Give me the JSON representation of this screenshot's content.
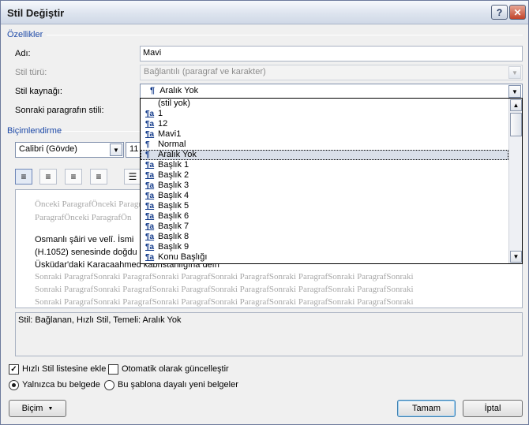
{
  "window": {
    "title": "Stil Değiştir",
    "help_label": "?",
    "close_label": "✕"
  },
  "properties": {
    "group_label": "Özellikler",
    "name_label": "Adı:",
    "name_value": "Mavi",
    "type_label": "Stil türü:",
    "type_value": "Bağlantılı (paragraf ve karakter)",
    "based_on_label": "Stil kaynağı:",
    "based_on_value": "Aralık Yok",
    "based_on_icon": "¶",
    "next_style_label": "Sonraki paragrafın stili:"
  },
  "style_list": {
    "items": [
      {
        "label": "(stil yok)",
        "icon": ""
      },
      {
        "label": "1",
        "icon": "¶a"
      },
      {
        "label": "12",
        "icon": "¶a"
      },
      {
        "label": "Mavi1",
        "icon": "¶a"
      },
      {
        "label": "Normal",
        "icon": "¶"
      },
      {
        "label": "Aralık Yok",
        "icon": "¶"
      },
      {
        "label": "Başlık 1",
        "icon": "¶a"
      },
      {
        "label": "Başlık 2",
        "icon": "¶a"
      },
      {
        "label": "Başlık 3",
        "icon": "¶a"
      },
      {
        "label": "Başlık 4",
        "icon": "¶a"
      },
      {
        "label": "Başlık 5",
        "icon": "¶a"
      },
      {
        "label": "Başlık 6",
        "icon": "¶a"
      },
      {
        "label": "Başlık 7",
        "icon": "¶a"
      },
      {
        "label": "Başlık 8",
        "icon": "¶a"
      },
      {
        "label": "Başlık 9",
        "icon": "¶a"
      },
      {
        "label": "Konu Başlığı",
        "icon": "¶a"
      }
    ],
    "selected_label": "Aralık Yok"
  },
  "formatting": {
    "group_label": "Biçimlendirme",
    "font_value": "Calibri (Gövde)",
    "size_value": "11"
  },
  "preview": {
    "prev_line_1": "Önceki ParagrafÖnceki Paragraf",
    "prev_line_2": "ParagrafÖnceki ParagrafÖn",
    "body_line_1": "Osmanlı şâiri ve velî. İsmi",
    "body_line_2": "(H.1052) senesinde doğdu",
    "body_line_3": "Üsküdar'daki Karacaahmed kabristanlığına defn",
    "next_line": "Sonraki ParagrafSonraki ParagrafSonraki ParagrafSonraki ParagrafSonraki ParagrafSonraki ParagrafSonraki"
  },
  "description": "Stil: Bağlanan, Hızlı Stil, Temeli: Aralık Yok",
  "options": {
    "add_quick_style": "Hızlı Stil listesine ekle",
    "auto_update": "Otomatik olarak güncelleştir",
    "only_this_doc": "Yalnızca bu belgede",
    "new_docs": "Bu şablona dayalı yeni belgeler"
  },
  "buttons": {
    "format": "Biçim",
    "ok": "Tamam",
    "cancel": "İptal"
  },
  "icons": {
    "dropdown_arrow": "chevron-down-icon",
    "scroll_up": "chevron-up-icon"
  }
}
